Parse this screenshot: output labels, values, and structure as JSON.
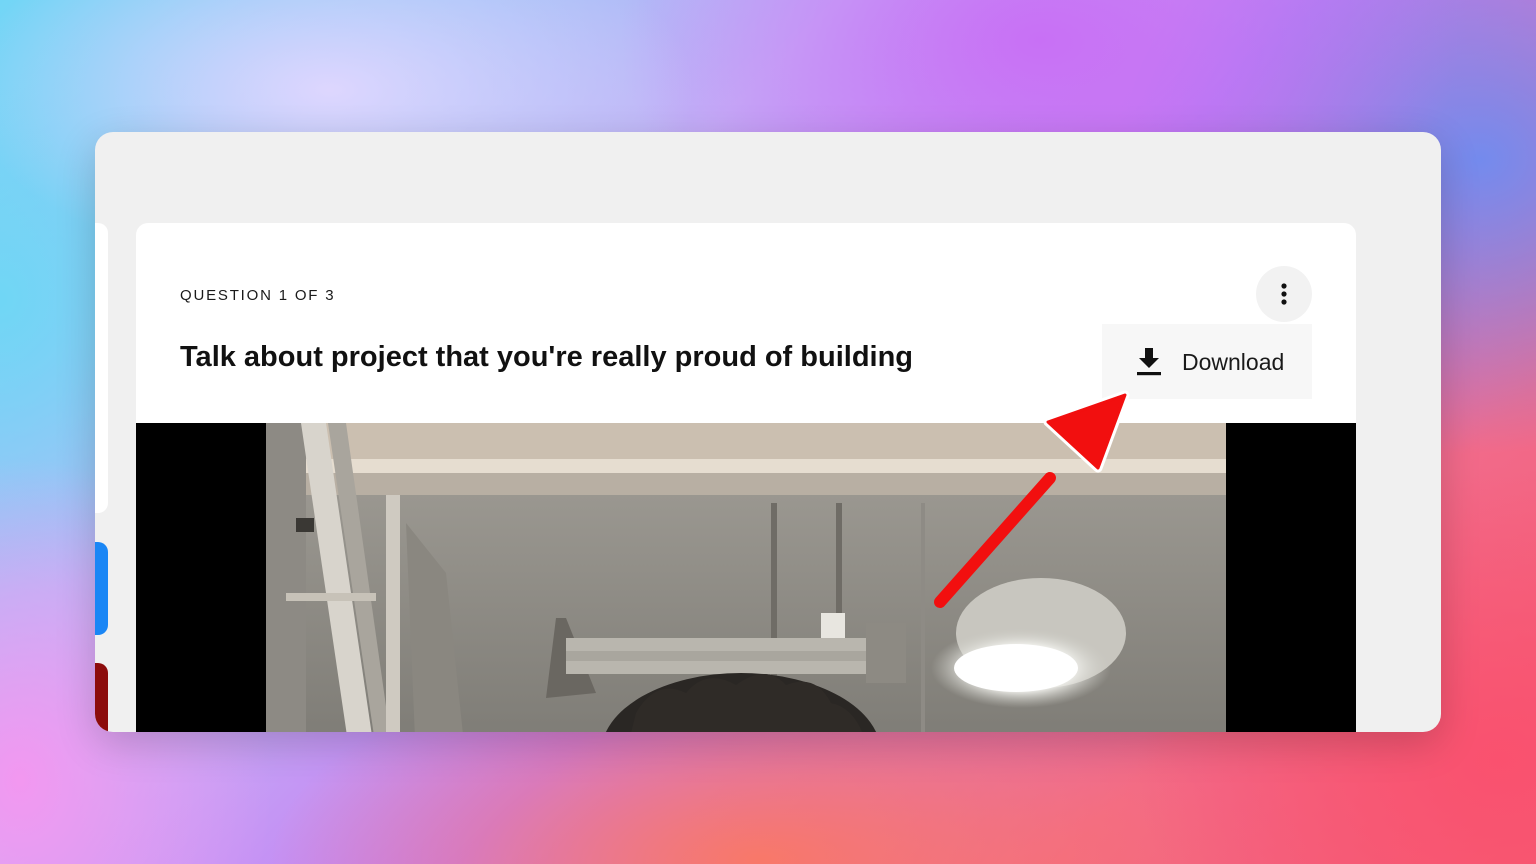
{
  "question": {
    "counter": "QUESTION 1 OF 3",
    "title": "Talk about project that you're really proud of building"
  },
  "menu": {
    "more_icon": "more-vertical-icon",
    "download_label": "Download",
    "download_icon": "download-icon"
  },
  "video": {
    "description_icon": "video-frame"
  },
  "colors": {
    "arrow": "#f20f0f",
    "side_blue": "#1a86f5",
    "side_red": "#8c0c0c"
  }
}
